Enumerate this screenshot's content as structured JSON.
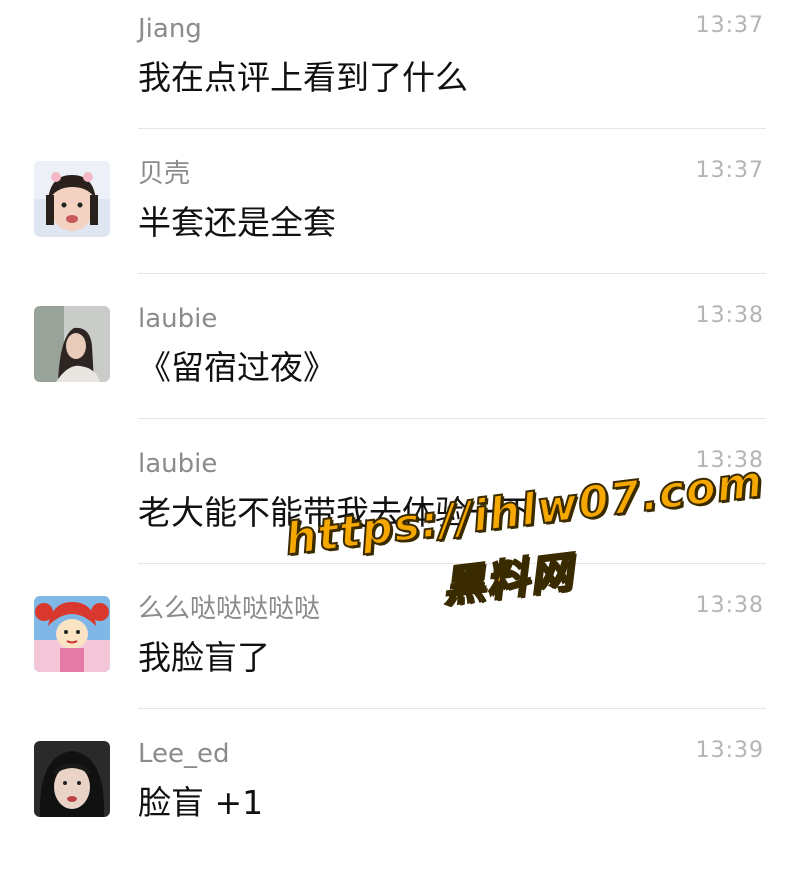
{
  "messages": [
    {
      "name": "Jiang",
      "time": "13:37",
      "text": "我在点评上看到了什么"
    },
    {
      "name": "贝壳",
      "time": "13:37",
      "text": "半套还是全套"
    },
    {
      "name": "laubie",
      "time": "13:38",
      "text": "《留宿过夜》"
    },
    {
      "name": "laubie",
      "time": "13:38",
      "text": "老大能不能带我去体验一下"
    },
    {
      "name": "么么哒哒哒哒哒",
      "time": "13:38",
      "text": "我脸盲了"
    },
    {
      "name": "Lee_ed",
      "time": "13:39",
      "text": "脸盲 +1"
    }
  ],
  "watermark": {
    "url": "https://ihlw07.com",
    "site": "黑料网"
  },
  "colors": {
    "name": "#8b8b8b",
    "time": "#b4b4b4",
    "text": "#111111",
    "divider": "#e6e6e6",
    "watermark": "#f6a800"
  }
}
